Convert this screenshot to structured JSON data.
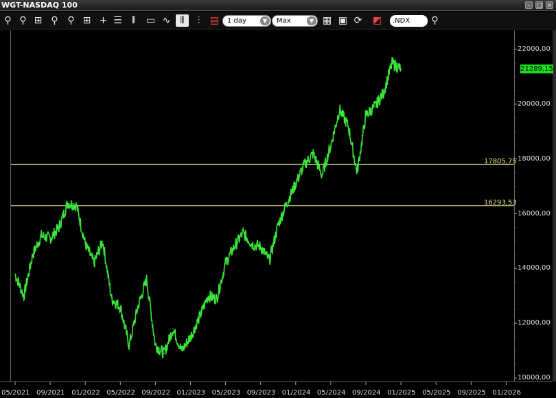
{
  "window": {
    "title": "WGT-NASDAQ 100",
    "buttons": [
      "minimize",
      "restore",
      "close"
    ]
  },
  "toolbar": {
    "interval": "1 day",
    "range": "Max",
    "symbol": ".NDX"
  },
  "chart_data": {
    "type": "line",
    "title": "",
    "xlabel": "",
    "ylabel": "",
    "x_ticks": [
      "05/2021",
      "09/2021",
      "01/2022",
      "05/2022",
      "09/2022",
      "01/2023",
      "05/2023",
      "09/2023",
      "01/2024",
      "05/2024",
      "09/2024",
      "01/2025",
      "05/2025",
      "09/2025",
      "01/2026"
    ],
    "y_ticks": [
      "10000,00",
      "12000,00",
      "14000,00",
      "16000,00",
      "18000,00",
      "20000,00",
      "22000,00"
    ],
    "ylim": [
      10000,
      22500
    ],
    "last_price_label": "21289,15",
    "horizontal_lines": [
      {
        "label": "17805,75",
        "value": 17805.75,
        "color": "#f0e68c"
      },
      {
        "label": "16293,53",
        "value": 16293.53,
        "color": "#f0e68c"
      }
    ],
    "series": [
      {
        "color": "#39e639",
        "x": [
          "2021-05",
          "2021-06",
          "2021-07",
          "2021-08",
          "2021-09",
          "2021-10",
          "2021-11",
          "2021-12",
          "2022-01",
          "2022-02",
          "2022-03",
          "2022-04",
          "2022-05",
          "2022-06",
          "2022-07",
          "2022-08",
          "2022-09",
          "2022-10",
          "2022-11",
          "2022-12",
          "2023-01",
          "2023-02",
          "2023-03",
          "2023-04",
          "2023-05",
          "2023-06",
          "2023-07",
          "2023-08",
          "2023-09",
          "2023-10",
          "2023-11",
          "2023-12",
          "2024-01",
          "2024-02",
          "2024-03",
          "2024-04",
          "2024-05",
          "2024-06",
          "2024-07",
          "2024-08",
          "2024-09",
          "2024-10",
          "2024-11",
          "2024-12",
          "2025-01"
        ],
        "values": [
          13800,
          13000,
          14500,
          15200,
          15100,
          15500,
          16400,
          16300,
          14900,
          14200,
          15000,
          12900,
          12600,
          11200,
          12600,
          13600,
          11200,
          10900,
          11800,
          11000,
          11500,
          12200,
          13000,
          12900,
          14200,
          14800,
          15300,
          14900,
          14800,
          14300,
          15600,
          16400,
          17100,
          17800,
          18200,
          17400,
          18500,
          19800,
          19200,
          17500,
          19600,
          19900,
          20400,
          21500,
          21289
        ]
      }
    ]
  }
}
